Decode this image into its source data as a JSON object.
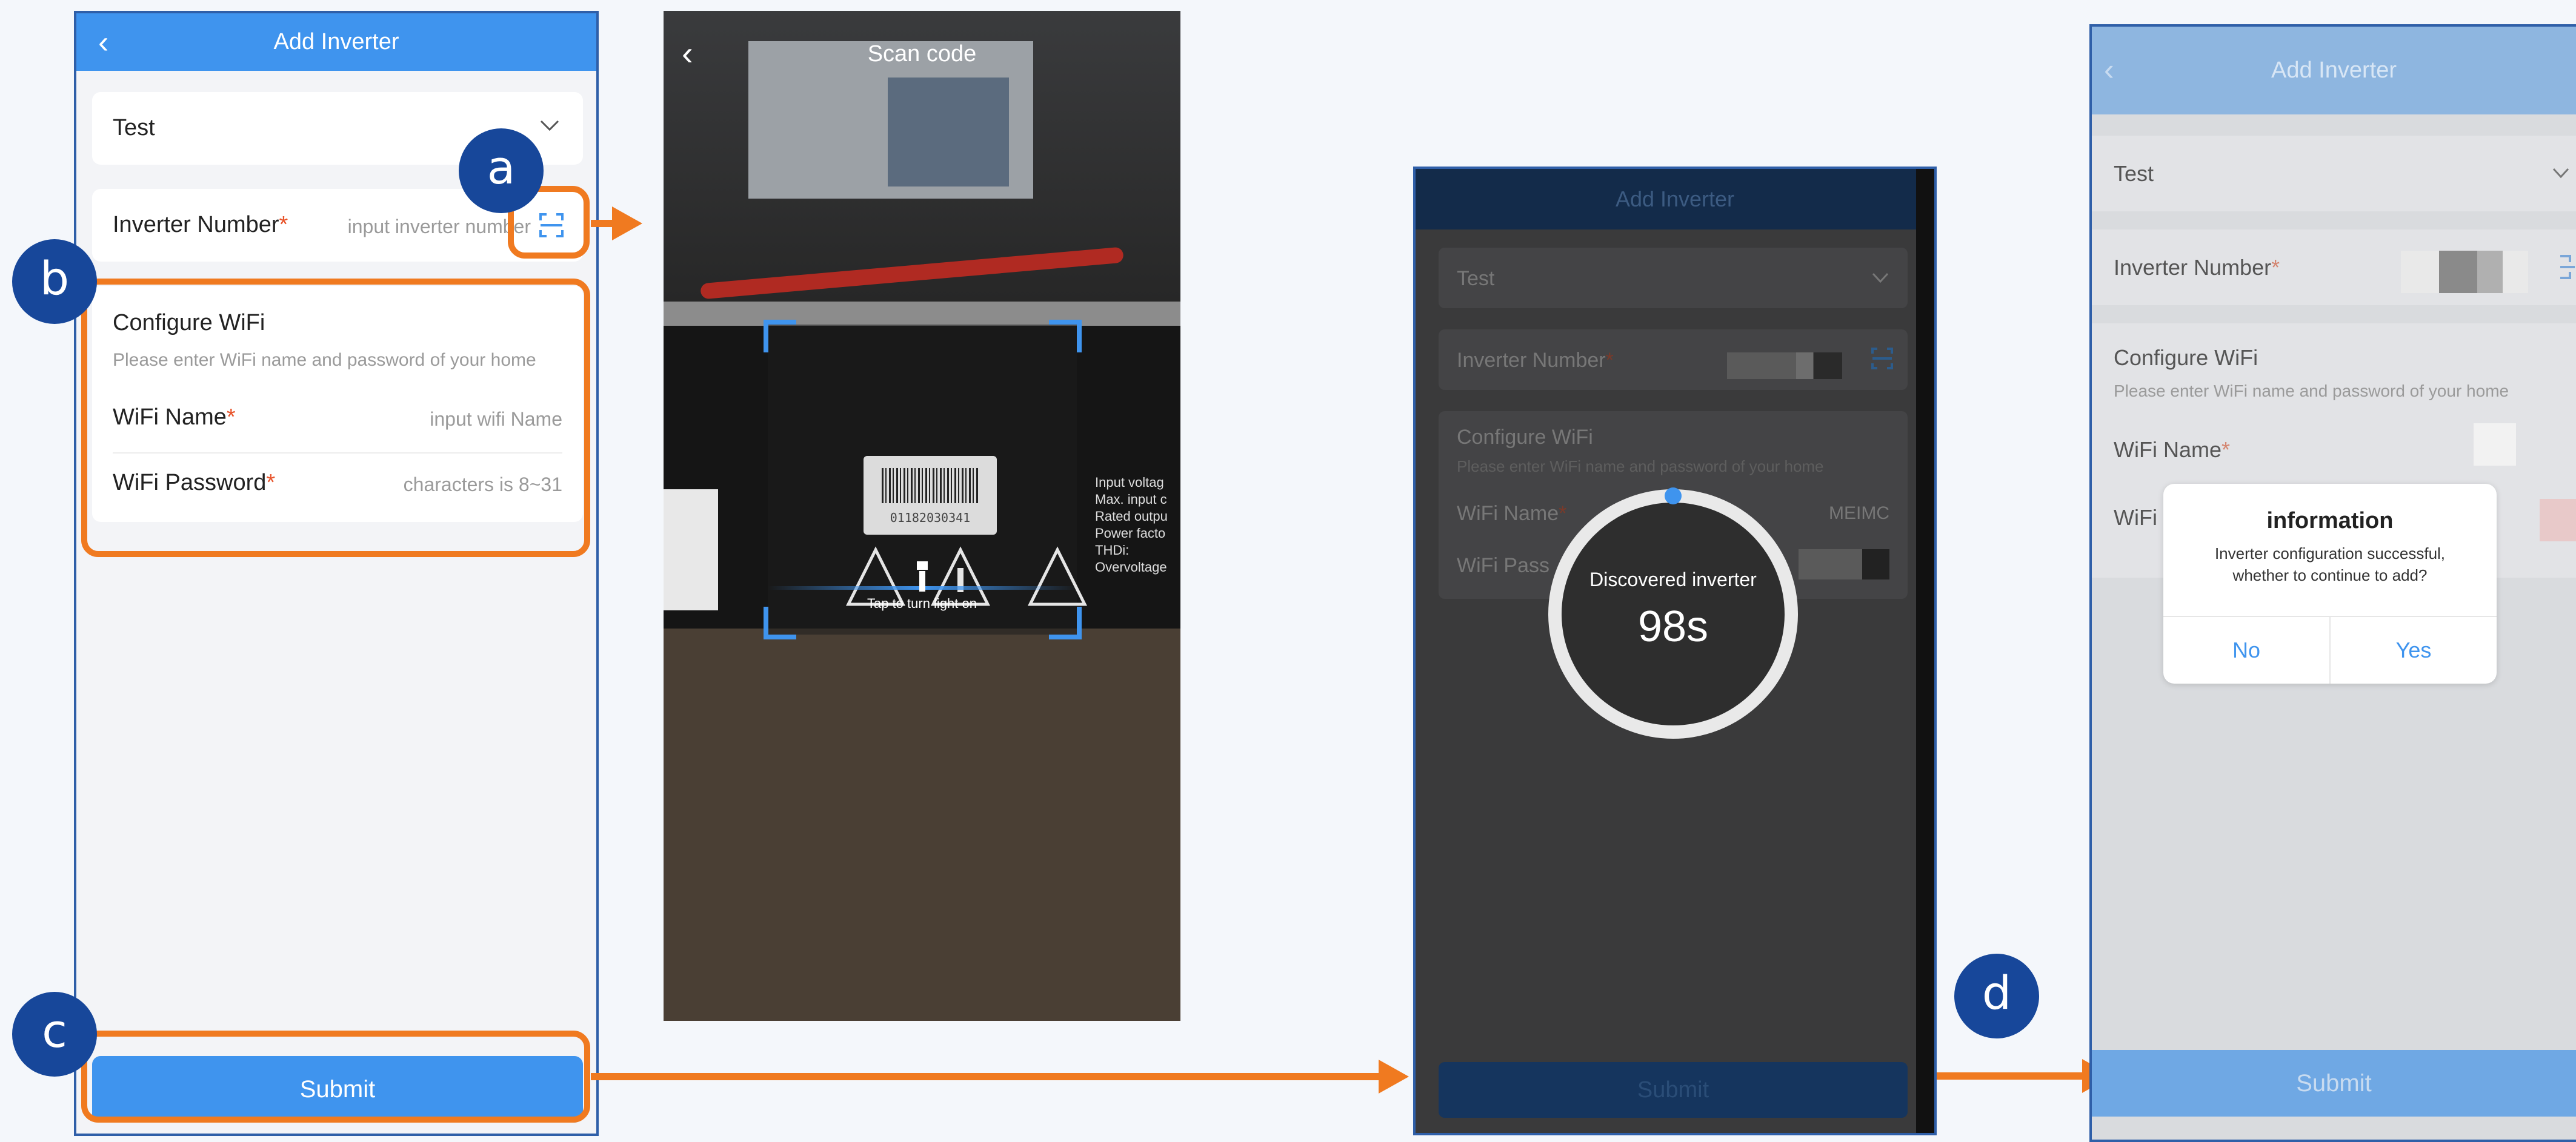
{
  "screen1": {
    "title": "Add Inverter",
    "back_icon": "‹",
    "plant_value": "Test",
    "inverter_label": "Inverter Number",
    "required_mark": "*",
    "inverter_placeholder": "input inverter number",
    "wifi_heading": "Configure WiFi",
    "wifi_hint": "Please enter WiFi name and password of your home",
    "wifi_name_label": "WiFi Name",
    "wifi_name_placeholder": "input wifi Name",
    "wifi_password_label": "WiFi Password",
    "wifi_password_placeholder": "characters is 8~31",
    "submit_label": "Submit"
  },
  "screen2": {
    "title": "Scan code",
    "back_icon": "‹",
    "label_code": "01182030341",
    "torch_hint": "Tap to turn light on",
    "side_text": [
      "Input voltag",
      "Max. input c",
      "Rated outpu",
      "Power facto",
      "THDi:",
      "Overvoltage"
    ]
  },
  "screen3": {
    "title": "Add Inverter",
    "plant_value": "Test",
    "inverter_label": "Inverter Number",
    "wifi_heading": "Configure WiFi",
    "wifi_hint": "Please enter WiFi name and password of your home",
    "wifi_name_label": "WiFi Name",
    "wifi_name_value": "MEIMC",
    "wifi_password_label": "WiFi Pass",
    "discovered_text": "Discovered inverter",
    "countdown": "98s",
    "submit_label": "Submit",
    "countdown_progress": 0.98
  },
  "screen4": {
    "title": "Add Inverter",
    "plant_value": "Test",
    "inverter_label": "Inverter Number",
    "wifi_heading": "Configure WiFi",
    "wifi_hint": "Please enter WiFi name and password of your home",
    "wifi_name_label": "WiFi Name",
    "wifi_password_label": "WiFi",
    "dialog_title": "information",
    "dialog_message_1": "Inverter configuration successful,",
    "dialog_message_2": "whether to continue to add?",
    "dialog_no": "No",
    "dialog_yes": "Yes",
    "submit_label": "Submit"
  },
  "markers": {
    "a": "a",
    "b": "b",
    "c": "c",
    "d": "d"
  },
  "colors": {
    "accent": "#3f94ee",
    "highlight": "#f07a20",
    "marker": "#17479a",
    "required": "#e8542b"
  }
}
